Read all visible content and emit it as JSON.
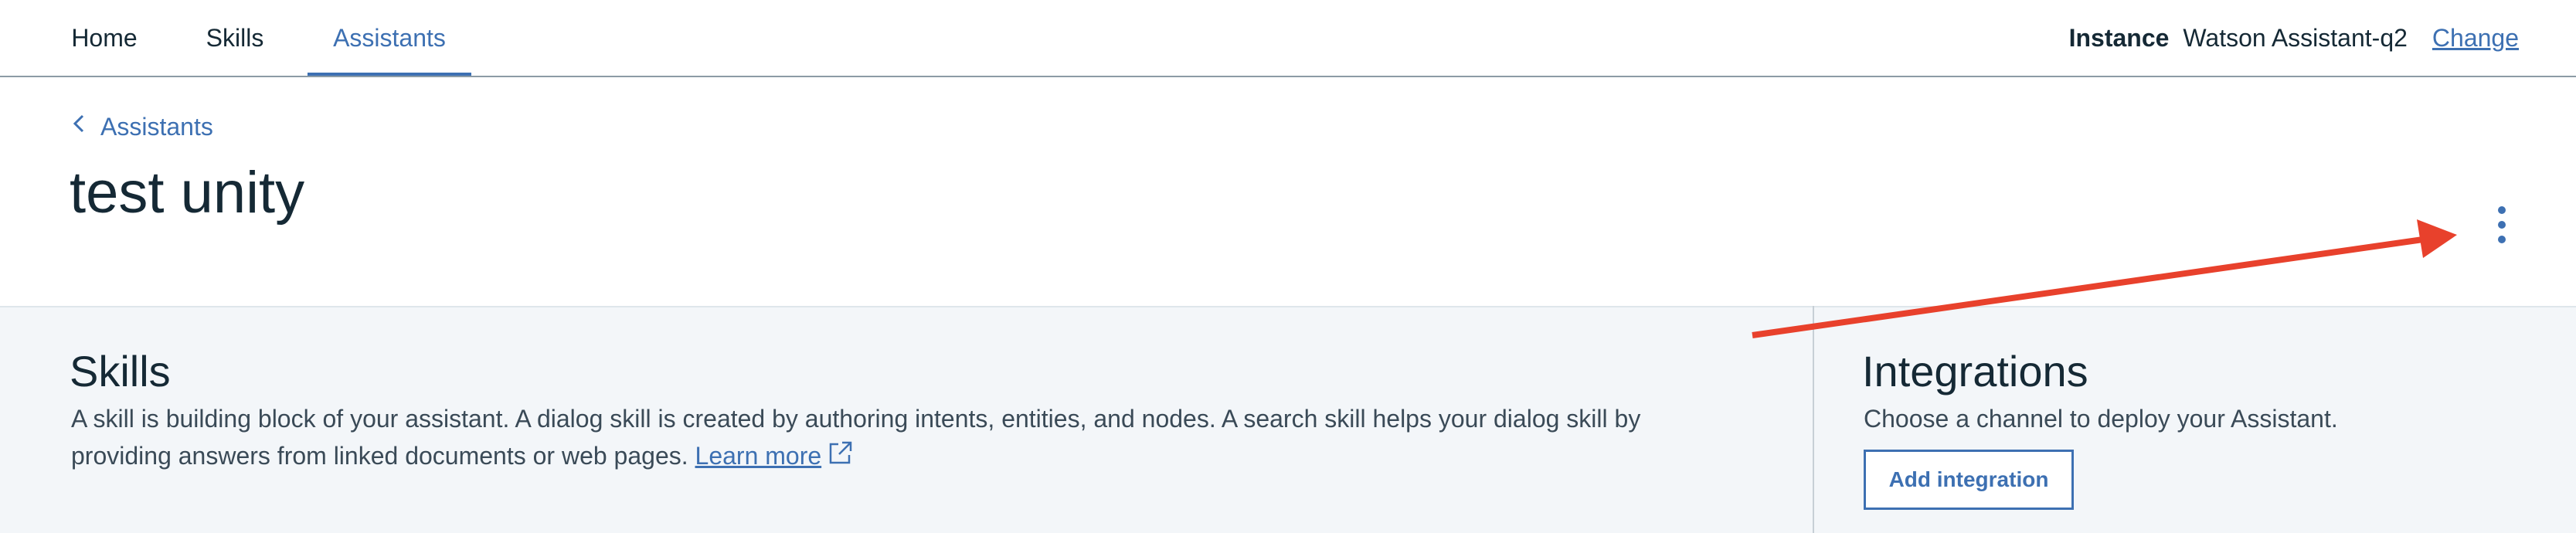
{
  "nav": {
    "tabs": [
      {
        "label": "Home"
      },
      {
        "label": "Skills"
      },
      {
        "label": "Assistants",
        "active": true
      }
    ],
    "instance_label": "Instance",
    "instance_value": "Watson Assistant-q2",
    "change_label": "Change"
  },
  "header": {
    "breadcrumb": "Assistants",
    "title": "test unity",
    "overflow_icon": "overflow-menu-vertical-icon"
  },
  "skills": {
    "title": "Skills",
    "description": "A skill is building block of your assistant. A dialog skill is created by authoring intents, entities, and nodes. A search skill helps your dialog skill by providing answers from linked documents or web pages.",
    "learn_more": "Learn more",
    "learn_more_icon": "external-link-icon"
  },
  "integrations": {
    "title": "Integrations",
    "description": "Choose a channel to deploy your Assistant.",
    "button_label": "Add integration"
  },
  "colors": {
    "accent": "#3d70b2",
    "text": "#152935",
    "panel_bg": "#f3f6f9",
    "annotation": "#e8412c"
  }
}
